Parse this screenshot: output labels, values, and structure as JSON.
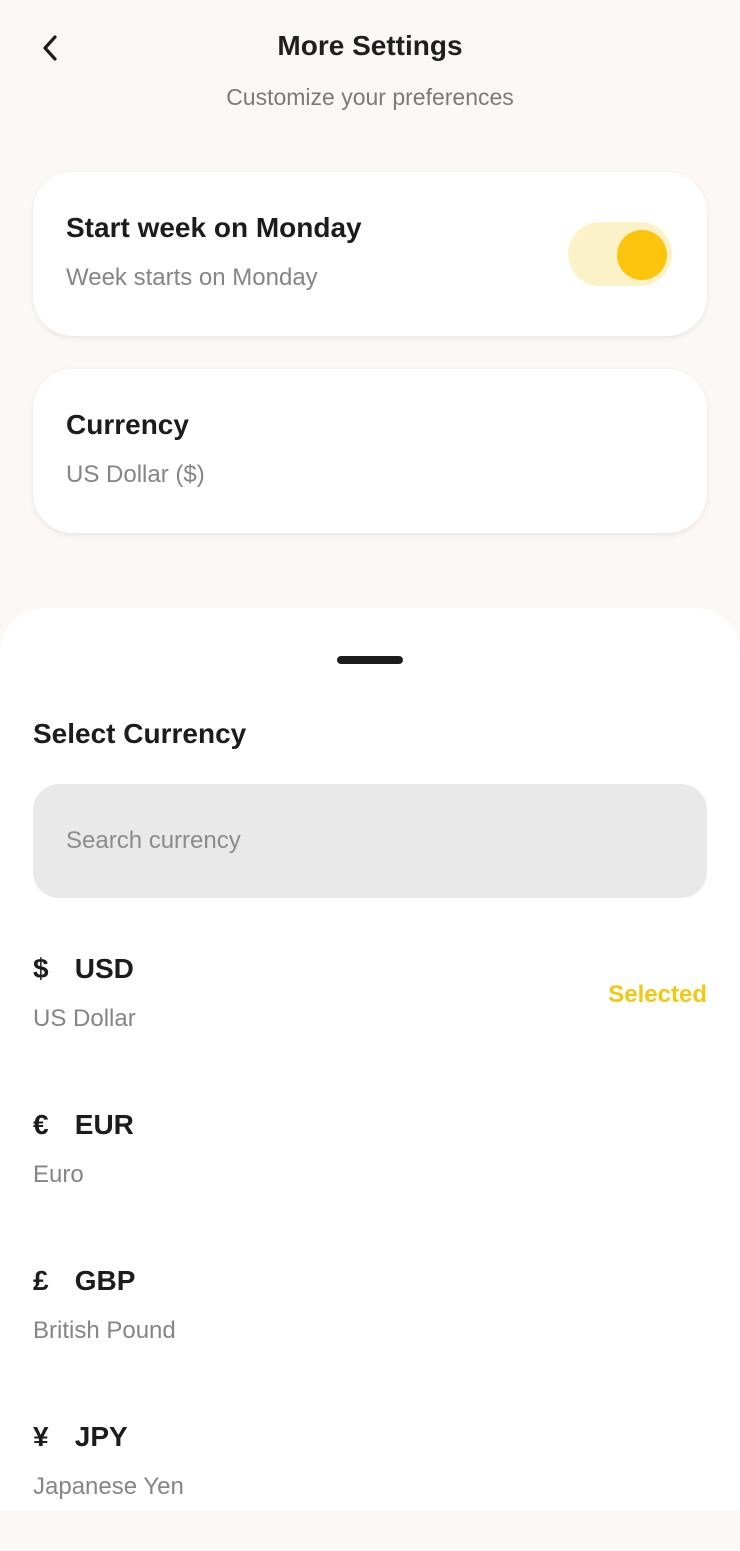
{
  "header": {
    "title": "More Settings",
    "subtitle": "Customize your preferences"
  },
  "settings": {
    "week": {
      "title": "Start week on Monday",
      "subtitle": "Week starts on Monday",
      "toggle_on": true
    },
    "currency": {
      "title": "Currency",
      "subtitle": "US Dollar ($)"
    }
  },
  "sheet": {
    "title": "Select Currency",
    "search_placeholder": "Search currency",
    "selected_label": "Selected",
    "currencies": [
      {
        "symbol": "$",
        "code": "USD",
        "name": "US Dollar",
        "selected": true
      },
      {
        "symbol": "€",
        "code": "EUR",
        "name": "Euro",
        "selected": false
      },
      {
        "symbol": "£",
        "code": "GBP",
        "name": "British Pound",
        "selected": false
      },
      {
        "symbol": "¥",
        "code": "JPY",
        "name": "Japanese Yen",
        "selected": false
      }
    ]
  },
  "colors": {
    "accent": "#fcc40d",
    "accent_light": "#fcf2c8",
    "selected_text": "#f3c812",
    "background": "#fbf8f6"
  },
  "icons": {
    "back": "chevron-left-icon"
  }
}
